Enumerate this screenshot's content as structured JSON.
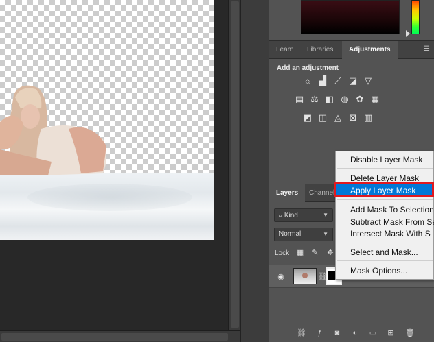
{
  "adjustments_tabs": [
    {
      "label": "Learn"
    },
    {
      "label": "Libraries"
    },
    {
      "label": "Adjustments"
    }
  ],
  "adjustments": {
    "heading": "Add an adjustment",
    "icons": [
      "brightness-icon",
      "levels-icon",
      "curves-icon",
      "exposure-icon",
      "vibrance-icon",
      "hue-saturation-icon",
      "color-balance-icon",
      "black-white-icon",
      "photo-filter-icon",
      "channel-mixer-icon",
      "color-lookup-icon",
      "invert-icon",
      "posterize-icon",
      "threshold-icon",
      "selective-color-icon",
      "gradient-map-icon"
    ]
  },
  "layers_tabs": [
    {
      "label": "Layers"
    },
    {
      "label": "Channel"
    }
  ],
  "layers": {
    "filter_kind": "Kind",
    "blend_mode": "Normal",
    "lock_label": "Lock:"
  },
  "context_menu": {
    "items": [
      {
        "label": "Disable Layer Mask"
      },
      {
        "label": "Delete Layer Mask"
      },
      {
        "label": "Apply Layer Mask",
        "highlighted": true
      },
      {
        "label": "Add Mask To Selection"
      },
      {
        "label": "Subtract Mask From Se"
      },
      {
        "label": "Intersect Mask With S"
      },
      {
        "label": "Select and Mask..."
      },
      {
        "label": "Mask Options..."
      }
    ]
  },
  "colors": {
    "panel_bg": "#535353",
    "tab_bar_bg": "#424242",
    "menu_highlight": "#0078d7",
    "callout_red": "#e0191f"
  }
}
